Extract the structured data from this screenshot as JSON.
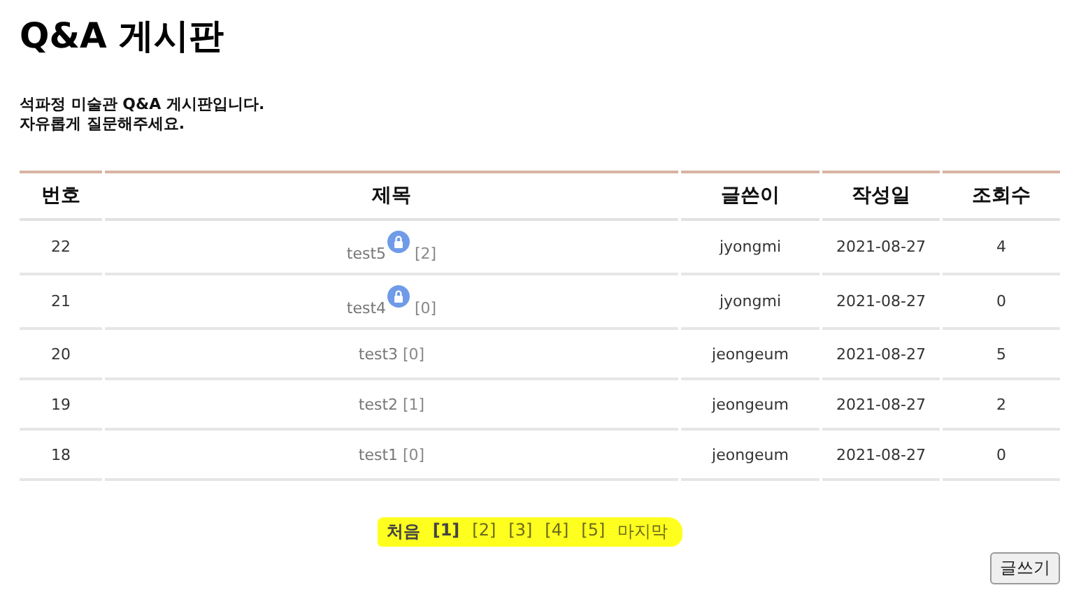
{
  "title": "Q&A 게시판",
  "intro": [
    "석파정 미술관 Q&A 게시판입니다.",
    "자유롭게 질문해주세요."
  ],
  "table": {
    "columns": [
      "번호",
      "제목",
      "글쓴이",
      "작성일",
      "조회수"
    ],
    "rows": [
      {
        "no": "22",
        "title": "test5",
        "locked": true,
        "comments": "[2]",
        "author": "jyongmi",
        "date": "2021-08-27",
        "views": "4"
      },
      {
        "no": "21",
        "title": "test4",
        "locked": true,
        "comments": "[0]",
        "author": "jyongmi",
        "date": "2021-08-27",
        "views": "0"
      },
      {
        "no": "20",
        "title": "test3",
        "locked": false,
        "comments": "[0]",
        "author": "jeongeum",
        "date": "2021-08-27",
        "views": "5"
      },
      {
        "no": "19",
        "title": "test2",
        "locked": false,
        "comments": "[1]",
        "author": "jeongeum",
        "date": "2021-08-27",
        "views": "2"
      },
      {
        "no": "18",
        "title": "test1",
        "locked": false,
        "comments": "[0]",
        "author": "jeongeum",
        "date": "2021-08-27",
        "views": "0"
      }
    ]
  },
  "pagination": [
    {
      "kind": "first",
      "label": "처음"
    },
    {
      "kind": "page",
      "label": "[1]",
      "selected": true
    },
    {
      "kind": "page",
      "label": "[2]",
      "selected": false
    },
    {
      "kind": "page",
      "label": "[3]",
      "selected": false
    },
    {
      "kind": "page",
      "label": "[4]",
      "selected": false
    },
    {
      "kind": "page",
      "label": "[5]",
      "selected": false
    },
    {
      "kind": "last",
      "label": "마지막"
    }
  ],
  "write_button": "글쓰기"
}
